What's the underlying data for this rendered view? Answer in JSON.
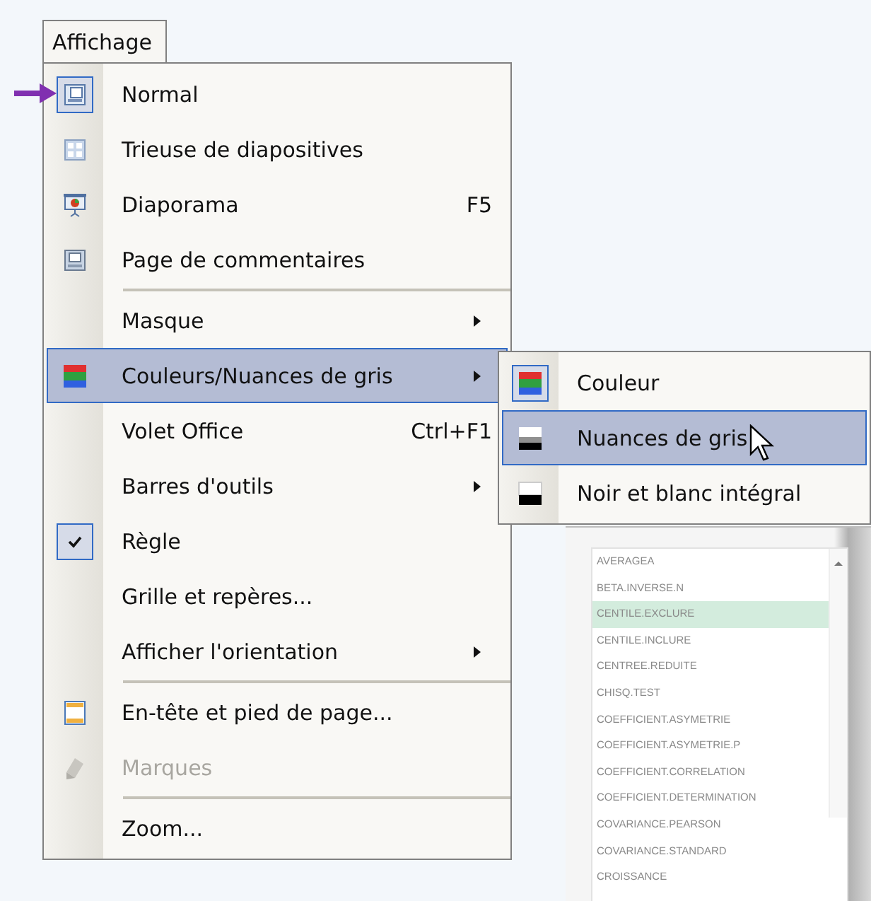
{
  "menu_bar": {
    "title": "Affichage"
  },
  "menu": {
    "sections": [
      {
        "items": [
          {
            "label": "Normal",
            "checked": true,
            "selected": false,
            "disabled": false
          },
          {
            "label": "Trieuse de diapositives",
            "checked": false,
            "selected": false,
            "disabled": false
          },
          {
            "label": "Diaporama",
            "shortcut": "F5",
            "checked": false,
            "selected": false,
            "disabled": false
          },
          {
            "label": "Page de commentaires",
            "checked": false,
            "selected": false,
            "disabled": false
          }
        ]
      },
      {
        "items": [
          {
            "label": "Masque",
            "submenu": true,
            "checked": false,
            "selected": false,
            "disabled": false
          },
          {
            "label": "Couleurs/Nuances de gris",
            "submenu": true,
            "checked": false,
            "selected": true,
            "disabled": false
          },
          {
            "label": "Volet Office",
            "shortcut": "Ctrl+F1",
            "checked": false,
            "selected": false,
            "disabled": false
          },
          {
            "label": "Barres d'outils",
            "submenu": true,
            "checked": false,
            "selected": false,
            "disabled": false
          },
          {
            "label": "Règle",
            "checked": true,
            "selected": false,
            "disabled": false
          },
          {
            "label": "Grille et repères...",
            "checked": false,
            "selected": false,
            "disabled": false
          },
          {
            "label": "Afficher l'orientation",
            "submenu": true,
            "checked": false,
            "selected": false,
            "disabled": false
          }
        ]
      },
      {
        "items": [
          {
            "label": "En-tête et pied de page...",
            "checked": false,
            "selected": false,
            "disabled": false
          },
          {
            "label": "Marques",
            "checked": false,
            "selected": false,
            "disabled": true
          }
        ]
      },
      {
        "items": [
          {
            "label": "Zoom...",
            "checked": false,
            "selected": false,
            "disabled": false
          }
        ]
      }
    ]
  },
  "submenu": {
    "items": [
      {
        "label": "Couleur",
        "checked": true,
        "selected": false
      },
      {
        "label": "Nuances de gris",
        "checked": false,
        "selected": true
      },
      {
        "label": "Noir et blanc intégral",
        "checked": false,
        "selected": false
      }
    ]
  },
  "function_list": {
    "items": [
      {
        "label": "AVERAGEA",
        "selected": false
      },
      {
        "label": "BETA.INVERSE.N",
        "selected": false
      },
      {
        "label": "CENTILE.EXCLURE",
        "selected": true
      },
      {
        "label": "CENTILE.INCLURE",
        "selected": false
      },
      {
        "label": "CENTREE.REDUITE",
        "selected": false
      },
      {
        "label": "CHISQ.TEST",
        "selected": false
      },
      {
        "label": "COEFFICIENT.ASYMETRIE",
        "selected": false
      },
      {
        "label": "COEFFICIENT.ASYMETRIE.P",
        "selected": false
      },
      {
        "label": "COEFFICIENT.CORRELATION",
        "selected": false
      },
      {
        "label": "COEFFICIENT.DETERMINATION",
        "selected": false
      },
      {
        "label": "COVARIANCE.PEARSON",
        "selected": false
      },
      {
        "label": "COVARIANCE.STANDARD",
        "selected": false
      },
      {
        "label": "CROISSANCE",
        "selected": false
      }
    ]
  }
}
